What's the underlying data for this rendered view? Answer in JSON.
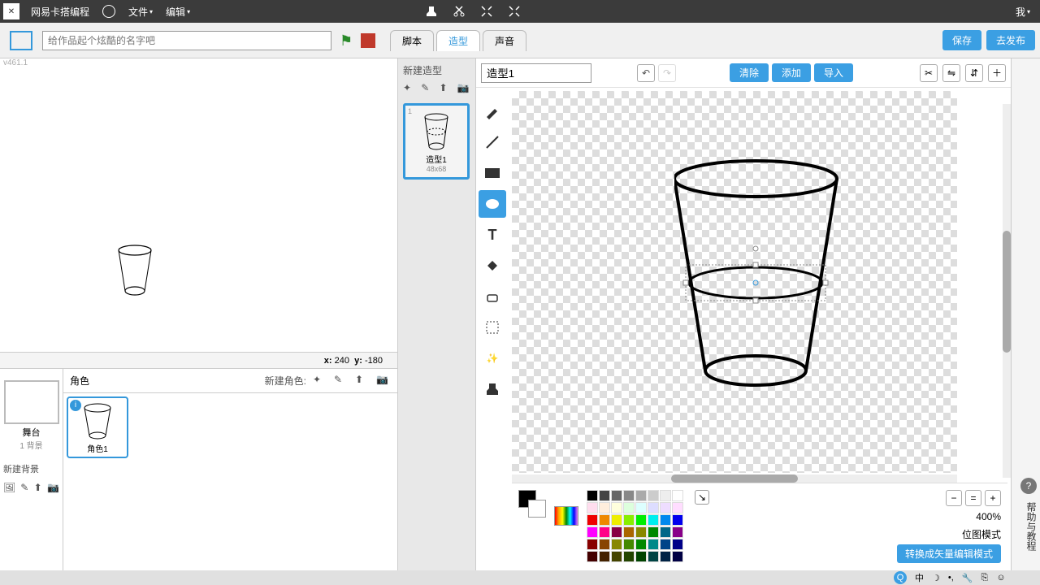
{
  "menu": {
    "brand": "网易卡搭编程",
    "file": "文件",
    "edit": "编辑",
    "me": "我"
  },
  "toolbar": {
    "title_placeholder": "给作品起个炫酷的名字吧",
    "version": "v461.1"
  },
  "tabs": {
    "scripts": "脚本",
    "costumes": "造型",
    "sounds": "声音"
  },
  "buttons": {
    "save": "保存",
    "publish": "去发布",
    "clear": "清除",
    "add": "添加",
    "import": "导入",
    "vector_mode": "转换成矢量编辑模式"
  },
  "costume": {
    "new_label": "新建造型",
    "name": "造型1",
    "thumb_size": "48x68",
    "thumb_num": "1"
  },
  "stage": {
    "x_label": "x:",
    "x": "240",
    "y_label": "y:",
    "y": "-180",
    "thumb_label": "舞台",
    "bg_count": "1 背景",
    "new_bg": "新建背景"
  },
  "sprite": {
    "header": "角色",
    "new_label": "新建角色:",
    "item1": "角色1"
  },
  "zoom": {
    "level": "400%",
    "mode": "位图模式"
  },
  "help": {
    "q": "?",
    "text": "帮助与教程"
  },
  "ime": {
    "zhong": "中"
  },
  "palette_row1": [
    "#000",
    "#444",
    "#666",
    "#888",
    "#aaa",
    "#ccc",
    "#eee",
    "#fff"
  ],
  "palette_row2": [
    "#fde",
    "#fed",
    "#ffd",
    "#dfd",
    "#dff",
    "#ddf",
    "#edf",
    "#fdf"
  ],
  "palette_row3": [
    "#e00",
    "#e80",
    "#ee0",
    "#8e0",
    "#0e0",
    "#0ee",
    "#08e",
    "#00e"
  ],
  "palette_row4": [
    "#f0f",
    "#f08",
    "#804",
    "#a60",
    "#880",
    "#080",
    "#068",
    "#808"
  ],
  "palette_row5": [
    "#800",
    "#840",
    "#880",
    "#480",
    "#080",
    "#088",
    "#048",
    "#008"
  ],
  "palette_row6": [
    "#400",
    "#420",
    "#440",
    "#240",
    "#040",
    "#044",
    "#024",
    "#004"
  ]
}
